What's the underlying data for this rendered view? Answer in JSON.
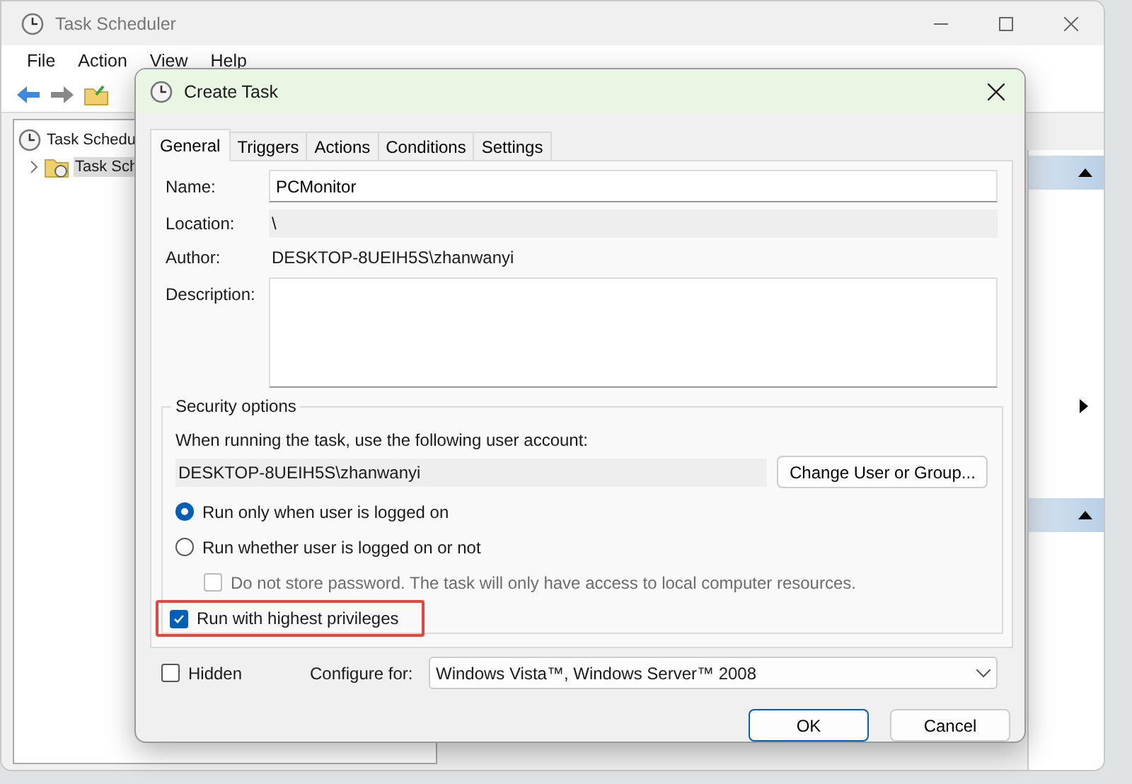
{
  "main_window": {
    "title": "Task Scheduler",
    "menu": [
      "File",
      "Action",
      "View",
      "Help"
    ],
    "tree": [
      {
        "label": "Task Schedu",
        "selected": false,
        "children": [
          {
            "label": "Task Sch",
            "selected": true
          }
        ]
      }
    ]
  },
  "dialog": {
    "title": "Create Task",
    "tabs": [
      {
        "label": "General",
        "selected": true
      },
      {
        "label": "Triggers",
        "selected": false
      },
      {
        "label": "Actions",
        "selected": false
      },
      {
        "label": "Conditions",
        "selected": false
      },
      {
        "label": "Settings",
        "selected": false
      }
    ],
    "name": {
      "label": "Name:",
      "value": "PCMonitor"
    },
    "location": {
      "label": "Location:",
      "value": "\\"
    },
    "author": {
      "label": "Author:",
      "value": "DESKTOP-8UEIH5S\\zhanwanyi"
    },
    "description": {
      "label": "Description:"
    },
    "security": {
      "title": "Security options",
      "prompt": "When running the task, use the following user account:",
      "account": "DESKTOP-8UEIH5S\\zhanwanyi",
      "change_button": "Change User or Group...",
      "options": [
        {
          "label": "Run only when user is logged on",
          "selected": true
        },
        {
          "label": "Run whether user is logged on or not",
          "selected": false
        }
      ],
      "do_not_store": {
        "label": "Do not store password.  The task will only have access to local computer resources.",
        "checked": false,
        "disabled": true
      },
      "highest": {
        "label": "Run with highest privileges",
        "checked": true,
        "highlighted": true
      }
    },
    "hidden": {
      "label": "Hidden",
      "checked": false
    },
    "configure": {
      "label": "Configure for:",
      "value": "Windows Vista™, Windows Server™ 2008"
    },
    "buttons": [
      {
        "label": "OK",
        "kind": "default"
      },
      {
        "label": "Cancel",
        "kind": "normal"
      }
    ]
  }
}
